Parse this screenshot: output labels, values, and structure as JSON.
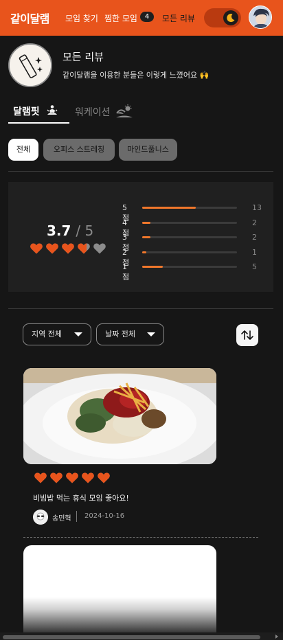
{
  "header": {
    "logo": "같이달램",
    "nav": {
      "find": "모임 찾기",
      "favorites": "찜한 모임",
      "favorites_count": "4",
      "reviews": "모든 리뷰"
    },
    "theme_toggle": "dark",
    "accent": "#e8541c"
  },
  "hero": {
    "title": "모든 리뷰",
    "subtitle": "같이달램을 이용한 분들은 이렇게 느꼈어요 🙌"
  },
  "tabs": [
    {
      "label": "달램핏",
      "icon": "meditation-icon",
      "active": true
    },
    {
      "label": "워케이션",
      "icon": "beach-sun-icon",
      "active": false
    }
  ],
  "chips": [
    {
      "label": "전체",
      "active": true
    },
    {
      "label": "오피스 스트레칭",
      "active": false
    },
    {
      "label": "마인드풀니스",
      "active": false
    }
  ],
  "summary": {
    "average": "3.7",
    "max": "/ 5",
    "hearts_filled": 3.7,
    "bars": [
      {
        "label": "5점",
        "count": "13",
        "fraction": 0.565
      },
      {
        "label": "4점",
        "count": "2",
        "fraction": 0.087
      },
      {
        "label": "3점",
        "count": "2",
        "fraction": 0.087
      },
      {
        "label": "2점",
        "count": "1",
        "fraction": 0.043
      },
      {
        "label": "1점",
        "count": "5",
        "fraction": 0.217
      }
    ],
    "bar_color": "#f0772b"
  },
  "filters": {
    "region": "지역 전체",
    "date": "날짜 전체",
    "sort_icon": "sort-arrows-icon"
  },
  "reviews": [
    {
      "rating": 5,
      "text": "비빔밥 먹는 휴식 모임 좋아요!",
      "author": "송민혁",
      "date": "2024-10-16"
    }
  ]
}
